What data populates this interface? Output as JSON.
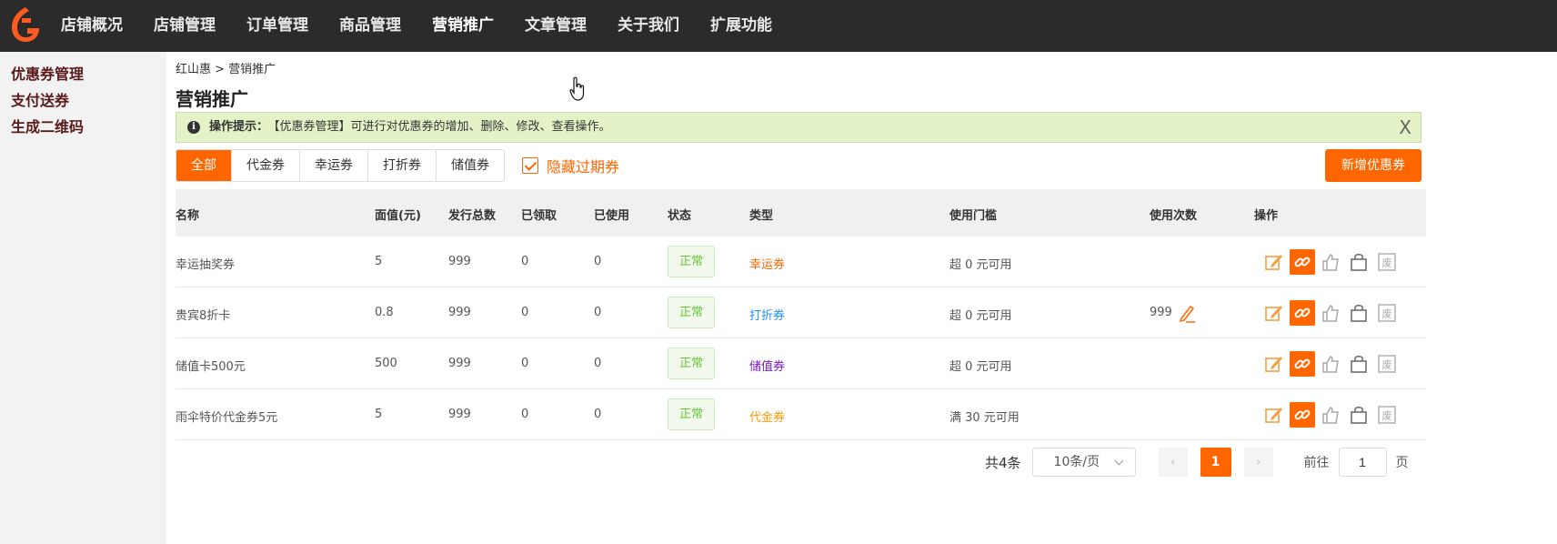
{
  "nav": {
    "items": [
      "店铺概况",
      "店铺管理",
      "订单管理",
      "商品管理",
      "营销推广",
      "文章管理",
      "关于我们",
      "扩展功能"
    ],
    "active_index": 4
  },
  "sidebar": {
    "items": [
      "优惠券管理",
      "支付送券",
      "生成二维码"
    ]
  },
  "breadcrumb": "红山惠 > 营销推广",
  "page_title": "营销推广",
  "tip": {
    "label": "操作提示：",
    "text": "【优惠券管理】可进行对优惠券的增加、删除、修改、查看操作。",
    "close": "X"
  },
  "tabs": [
    "全部",
    "代金券",
    "幸运券",
    "打折券",
    "储值券"
  ],
  "hide_expired": {
    "label": "隐藏过期券",
    "checked": true
  },
  "add_button": "新增优惠券",
  "table": {
    "headers": [
      "名称",
      "面值(元)",
      "发行总数",
      "已领取",
      "已使用",
      "状态",
      "类型",
      "使用门槛",
      "使用次数",
      "操作"
    ],
    "rows": [
      {
        "name": "幸运抽奖券",
        "value": "5",
        "total": "999",
        "received": "0",
        "used": "0",
        "status": "正常",
        "type": "幸运券",
        "type_key": "lucky",
        "threshold": "超 0 元可用",
        "times": ""
      },
      {
        "name": "贵宾8折卡",
        "value": "0.8",
        "total": "999",
        "received": "0",
        "used": "0",
        "status": "正常",
        "type": "打折券",
        "type_key": "discount",
        "threshold": "超 0 元可用",
        "times": "999"
      },
      {
        "name": "储值卡500元",
        "value": "500",
        "total": "999",
        "received": "0",
        "used": "0",
        "status": "正常",
        "type": "储值券",
        "type_key": "stored",
        "threshold": "超 0 元可用",
        "times": ""
      },
      {
        "name": "雨伞特价代金券5元",
        "value": "5",
        "total": "999",
        "received": "0",
        "used": "0",
        "status": "正常",
        "type": "代金券",
        "type_key": "voucher",
        "threshold": "满 30 元可用",
        "times": ""
      }
    ]
  },
  "pagination": {
    "total": "共4条",
    "page_size": "10条/页",
    "current_page": "1",
    "goto_label": "前往",
    "goto_value": "1",
    "goto_unit": "页"
  },
  "colors": {
    "accent": "#ff6600",
    "topbar": "#2b2b2b",
    "tip_bg": "#e4f3c7",
    "status_green": "#67c23a"
  },
  "icons": [
    "logo-icon",
    "info-icon",
    "edit-icon",
    "link-icon",
    "thumb-up-icon",
    "shopping-bag-icon",
    "void-icon",
    "pen-icon",
    "hand-cursor-icon"
  ]
}
